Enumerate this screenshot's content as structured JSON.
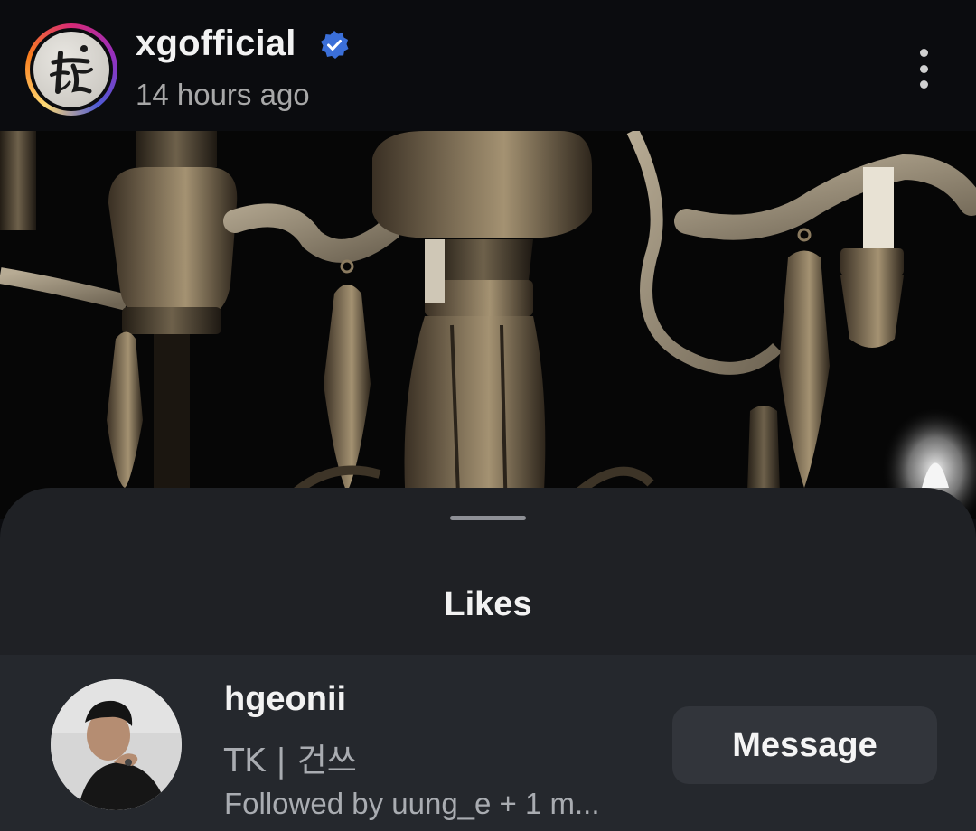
{
  "post": {
    "author": {
      "username": "xgofficial",
      "verified": true,
      "avatar_icon": "calligraphy-logo"
    },
    "timestamp": "14 hours ago",
    "more_icon": "vertical-ellipsis-icon",
    "image_subject": "antique brass chandelier on black background"
  },
  "likes_sheet": {
    "title": "Likes",
    "items": [
      {
        "username": "hgeonii",
        "full_name": "TK | 건쓰",
        "followed_by": "Followed by uung_e + 1 m...",
        "action_label": "Message"
      }
    ]
  },
  "colors": {
    "background": "#0b0c0f",
    "sheet": "#1f2125",
    "list_row": "#25282d",
    "button": "#32353b",
    "verified_badge": "#3b6fd8",
    "secondary_text": "#a9acb1"
  }
}
